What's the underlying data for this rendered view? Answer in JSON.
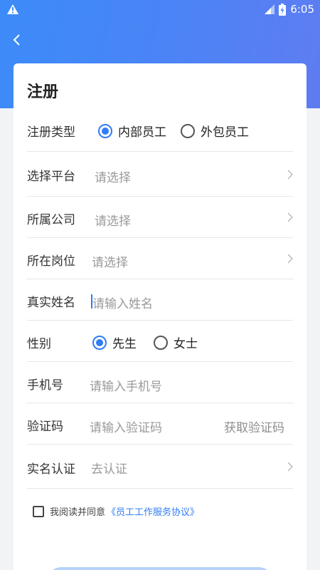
{
  "status_bar": {
    "time": "6:05"
  },
  "form": {
    "title": "注册",
    "register_type": {
      "label": "注册类型",
      "options": [
        "内部员工",
        "外包员工"
      ],
      "selected": "内部员工"
    },
    "platform": {
      "label": "选择平台",
      "placeholder": "请选择"
    },
    "company": {
      "label": "所属公司",
      "placeholder": "请选择"
    },
    "position": {
      "label": "所在岗位",
      "placeholder": "请选择"
    },
    "real_name": {
      "label": "真实姓名",
      "placeholder": "请输入姓名"
    },
    "gender": {
      "label": "性别",
      "options": [
        "先生",
        "女士"
      ],
      "selected": "先生"
    },
    "phone": {
      "label": "手机号",
      "placeholder": "请输入手机号"
    },
    "code": {
      "label": "验证码",
      "placeholder": "请输入验证码",
      "get_code": "获取验证码"
    },
    "verify": {
      "label": "实名认证",
      "placeholder": "去认证"
    },
    "agreement": {
      "text": "我阅读并同意",
      "link": "《员工工作服务协议》"
    }
  },
  "colors": {
    "accent": "#2f7cf6",
    "header_start": "#3c8bf8",
    "header_end": "#5f7cf2"
  }
}
